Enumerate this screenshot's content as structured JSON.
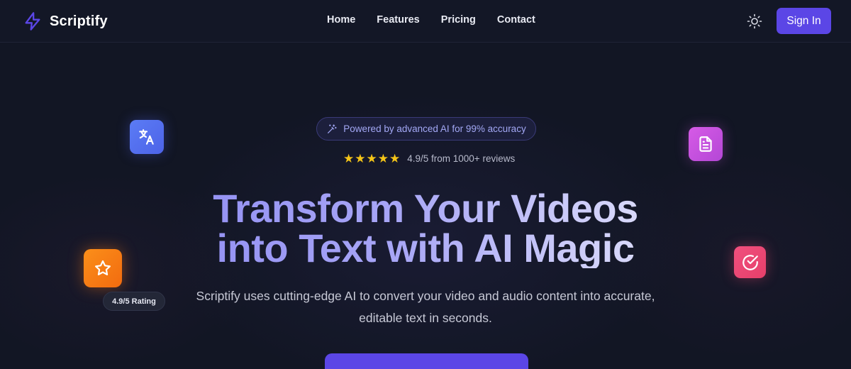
{
  "brand": {
    "name": "Scriptify",
    "accent": "#5b46e6"
  },
  "nav": {
    "links": [
      "Home",
      "Features",
      "Pricing",
      "Contact"
    ],
    "theme_icon": "sun-icon",
    "signin_label": "Sign In"
  },
  "hero": {
    "badge_icon": "magic-wand-icon",
    "badge_text": "Powered by advanced AI for 99% accuracy",
    "stars": 5,
    "rating_text": "4.9/5 from 1000+ reviews",
    "headline_line1": "Transform Your Videos",
    "headline_line2": "into Text with AI Magic",
    "subtitle_line1": "Scriptify uses cutting-edge AI to convert your video and audio content into accurate,",
    "subtitle_line2": "editable text in seconds."
  },
  "floating": {
    "translate_icon": "translate-icon",
    "document_icon": "document-icon",
    "star_icon": "star-icon",
    "check_icon": "check-circle-icon",
    "rating_pill": "4.9/5 Rating"
  }
}
